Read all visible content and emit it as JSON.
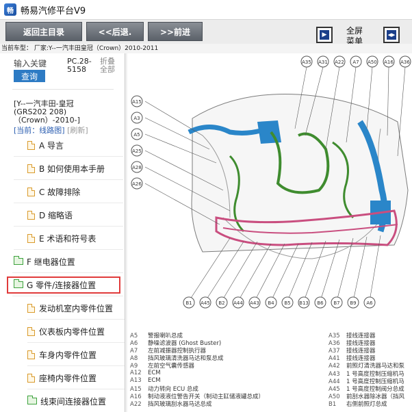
{
  "window": {
    "title": "畅易汽修平台V9",
    "icon": "app-logo-icon"
  },
  "toolbar": {
    "home_label": "返回主目录",
    "back_label": "<<后退.",
    "forward_label": ">>前进",
    "fullscreen_label_1": "全屏",
    "fullscreen_label_2": "菜单"
  },
  "car_model": "当前车型： 厂家:Y--一汽丰田皇冠（Crown）2010-2011",
  "sidebar": {
    "search_placeholder": "输入关键",
    "search_button": "查询",
    "pc_code_line1": "PC.28-",
    "pc_code_line2": "5158",
    "fold_line1": "折叠",
    "fold_line2": "全部",
    "vehicle_line1": "[Y--一汽丰田-皇冠",
    "vehicle_line2": "(GRS202 208)",
    "vehicle_line3": "（Crown）-2010-]",
    "current_label": "[当前：线路图]",
    "refresh_label": "[刷新]",
    "items": [
      {
        "label": "A 导言"
      },
      {
        "label": "B 如何使用本手册"
      },
      {
        "label": "C 故障排除"
      },
      {
        "label": "D 缩略语"
      },
      {
        "label": "E 术语和符号表"
      },
      {
        "label": "F 继电器位置"
      },
      {
        "label": "G 零件/连接器位置"
      },
      {
        "label": "发动机室内零件位置"
      },
      {
        "label": "仪表板内零件位置"
      },
      {
        "label": "车身内零件位置"
      },
      {
        "label": "座椅内零件位置"
      },
      {
        "label": "线束间连接器位置"
      }
    ]
  },
  "diagram": {
    "top_labels": [
      "A35",
      "A31",
      "A22",
      "A7",
      "A50",
      "A16",
      "A36"
    ],
    "left_labels": [
      "A15",
      "A3",
      "A5",
      "A25",
      "A28",
      "A26"
    ],
    "bottom_labels": [
      "B1",
      "A45",
      "B2",
      "A44",
      "A43",
      "B4",
      "B5",
      "B13",
      "B6",
      "B7",
      "B9",
      "A6"
    ],
    "legend_left": [
      {
        "code": "A5",
        "text": "警报喇叭总成"
      },
      {
        "code": "A6",
        "text": "静噪滤波器 (Ghost Buster)"
      },
      {
        "code": "A7",
        "text": "左前减振器控制执行器"
      },
      {
        "code": "A8",
        "text": "挡风玻璃清洗器马达和泵总成"
      },
      {
        "code": "A9",
        "text": "左前空气囊传感器"
      },
      {
        "code": "A12",
        "text": "ECM"
      },
      {
        "code": "A13",
        "text": "ECM"
      },
      {
        "code": "A15",
        "text": "动力转向 ECU 总成"
      },
      {
        "code": "A16",
        "text": "制动液液位警告开关（制动主缸储液罐总成）"
      },
      {
        "code": "A22",
        "text": "挡风玻璃刮水器马达总成"
      }
    ],
    "legend_right": [
      {
        "code": "A35",
        "text": "接线连接器"
      },
      {
        "code": "A36",
        "text": "接线连接器"
      },
      {
        "code": "A37",
        "text": "接线连接器"
      },
      {
        "code": "A41",
        "text": "接线连接器"
      },
      {
        "code": "A42",
        "text": "前照灯清洗器马达和泵"
      },
      {
        "code": "A43",
        "text": "1 号高度控制压缩机马"
      },
      {
        "code": "A44",
        "text": "1 号高度控制压缩机马"
      },
      {
        "code": "A45",
        "text": "1 号高度控制阀分总成"
      },
      {
        "code": "A50",
        "text": "前刮水器除冰器（挡风"
      },
      {
        "code": "B1",
        "text": "右侧前照灯总成"
      }
    ]
  },
  "colors": {
    "accent": "#2d7bc4",
    "selected_border": "#e03a3a",
    "button": "#6b7078"
  }
}
